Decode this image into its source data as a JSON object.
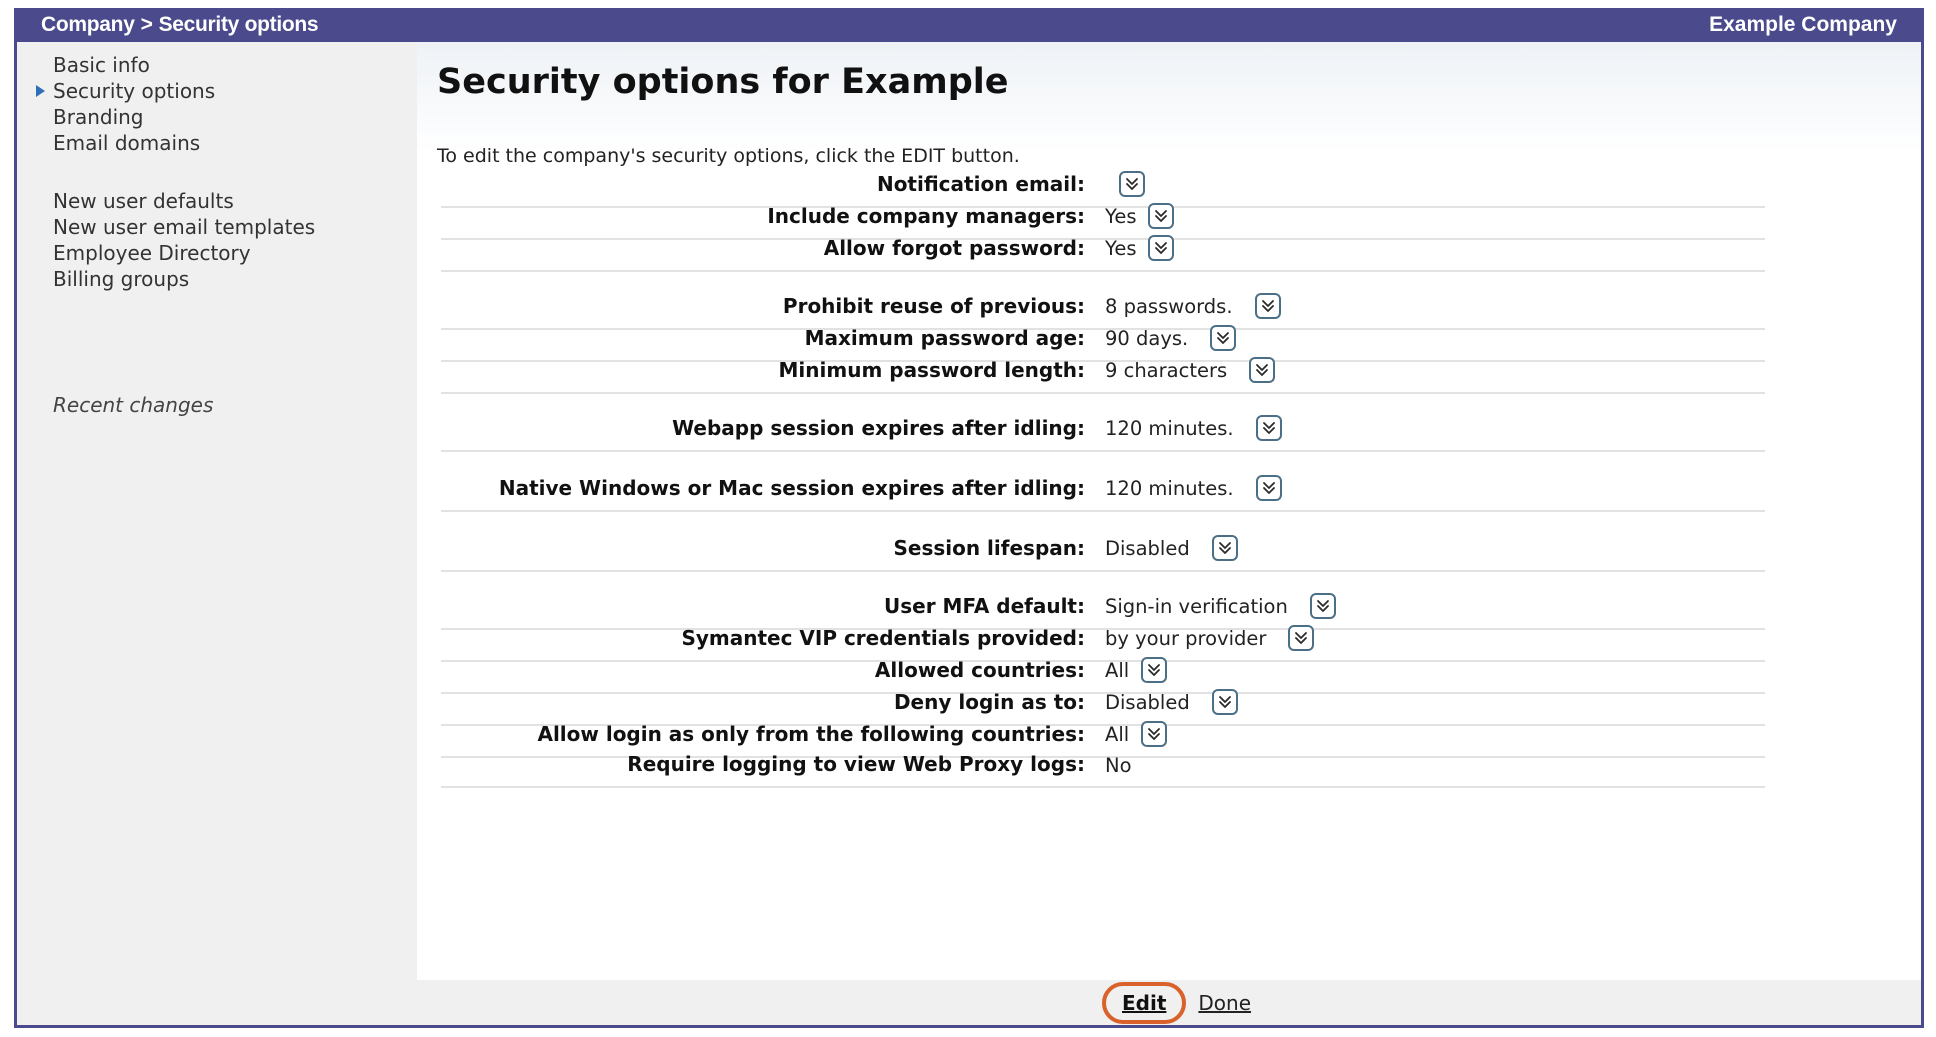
{
  "header": {
    "crumb_company": "Company",
    "crumb_sep": ">",
    "crumb_current": "Security options",
    "company_name": "Example Company"
  },
  "sidebar": {
    "items": [
      {
        "label": "Basic info"
      },
      {
        "label": "Security options",
        "active": true
      },
      {
        "label": "Branding"
      },
      {
        "label": "Email domains"
      },
      {
        "label": "New user defaults"
      },
      {
        "label": "New user email templates"
      },
      {
        "label": "Employee Directory"
      },
      {
        "label": "Billing groups"
      }
    ],
    "recent_changes": "Recent changes"
  },
  "main": {
    "title": "Security options for Example",
    "intro": "To edit the company's security options, click the EDIT button.",
    "rows": [
      {
        "label": "Notification email:",
        "value": ""
      },
      {
        "label": "Include company managers:",
        "value": "Yes"
      },
      {
        "label": "Allow forgot password:",
        "value": "Yes"
      },
      {
        "label": "Prohibit reuse of previous:",
        "value": "8 passwords."
      },
      {
        "label": "Maximum password age:",
        "value": "90 days."
      },
      {
        "label": "Minimum password length:",
        "value": "9 characters"
      },
      {
        "label": "Webapp session expires after idling:",
        "value": "120 minutes."
      },
      {
        "label": "Native Windows or Mac session expires after idling:",
        "value": "120 minutes."
      },
      {
        "label": "Session lifespan:",
        "value": "Disabled"
      },
      {
        "label": "User MFA default:",
        "value": "Sign-in verification"
      },
      {
        "label": "Symantec VIP credentials provided:",
        "value": "by your provider"
      },
      {
        "label": "Allowed countries:",
        "value": "All"
      },
      {
        "label": "Deny login as to:",
        "value": "Disabled"
      },
      {
        "label": "Allow login as only from the following countries:",
        "value": "All"
      },
      {
        "label": "Require logging to view Web Proxy logs:",
        "value": "No"
      }
    ]
  },
  "footer": {
    "edit_label": "Edit",
    "done_label": "Done"
  },
  "colors": {
    "titlebar": "#4a4a8c",
    "edit_highlight": "#d9622b",
    "active_arrow": "#2f6fb8"
  },
  "icons": {
    "expand": "chevron-double-down-icon",
    "active_marker": "triangle-right-icon"
  }
}
